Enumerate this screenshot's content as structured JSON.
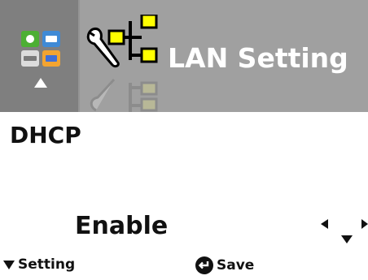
{
  "header": {
    "title": "LAN Setting",
    "menu_icons": [
      "app-icon",
      "printer-icon",
      "storage-icon",
      "network-card-icon"
    ]
  },
  "setting": {
    "label": "DHCP",
    "value": "Enable"
  },
  "footer": {
    "left_label": "Setting",
    "right_label": "Save"
  },
  "colors": {
    "header_bg": "#a0a0a0",
    "header_left_bg": "#7f7f7f",
    "icon_yellow": "#ffff00",
    "text": "#111111"
  }
}
